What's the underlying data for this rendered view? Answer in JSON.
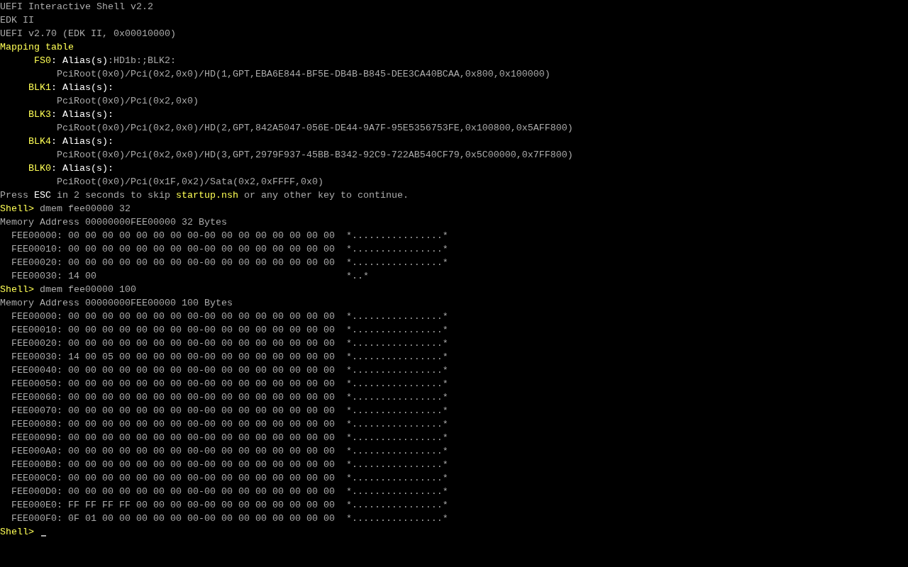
{
  "lines": [
    {
      "parts": [
        {
          "text": "UEFI Interactive Shell v2.2",
          "kind": "text"
        }
      ]
    },
    {
      "parts": [
        {
          "text": "EDK II",
          "kind": "text"
        }
      ]
    },
    {
      "parts": [
        {
          "text": "UEFI v2.70 (EDK II, 0x00010000)",
          "kind": "text"
        }
      ]
    },
    {
      "parts": [
        {
          "text": "Mapping table",
          "kind": "accent"
        }
      ]
    },
    {
      "kind": "mapping",
      "parts": [
        {
          "text": "FS0",
          "kind": "accent"
        },
        {
          "text": ": Alias(s)",
          "kind": "bright"
        },
        {
          "text": ":HD1b:;BLK2:",
          "kind": "text"
        }
      ]
    },
    {
      "parts": [
        {
          "text": "          PciRoot(0x0)/Pci(0x2,0x0)/HD(1,GPT,EBA6E844-BF5E-DB4B-B845-DEE3CA40BCAA,0x800,0x100000)",
          "kind": "text"
        }
      ]
    },
    {
      "kind": "mapping",
      "parts": [
        {
          "text": "BLK1",
          "kind": "accent"
        },
        {
          "text": ": Alias(s):",
          "kind": "bright"
        }
      ]
    },
    {
      "parts": [
        {
          "text": "          PciRoot(0x0)/Pci(0x2,0x0)",
          "kind": "text"
        }
      ]
    },
    {
      "kind": "mapping",
      "parts": [
        {
          "text": "BLK3",
          "kind": "accent"
        },
        {
          "text": ": Alias(s):",
          "kind": "bright"
        }
      ]
    },
    {
      "parts": [
        {
          "text": "          PciRoot(0x0)/Pci(0x2,0x0)/HD(2,GPT,842A5047-056E-DE44-9A7F-95E5356753FE,0x100800,0x5AFF800)",
          "kind": "text"
        }
      ]
    },
    {
      "kind": "mapping",
      "parts": [
        {
          "text": "BLK4",
          "kind": "accent"
        },
        {
          "text": ": Alias(s):",
          "kind": "bright"
        }
      ]
    },
    {
      "parts": [
        {
          "text": "          PciRoot(0x0)/Pci(0x2,0x0)/HD(3,GPT,2979F937-45BB-B342-92C9-722AB540CF79,0x5C00000,0x7FF800)",
          "kind": "text"
        }
      ]
    },
    {
      "kind": "mapping",
      "parts": [
        {
          "text": "BLK0",
          "kind": "accent"
        },
        {
          "text": ": Alias(s):",
          "kind": "bright"
        }
      ]
    },
    {
      "parts": [
        {
          "text": "          PciRoot(0x0)/Pci(0x1F,0x2)/Sata(0x2,0xFFFF,0x0)",
          "kind": "text"
        }
      ]
    },
    {
      "parts": [
        {
          "text": "Press ",
          "kind": "text"
        },
        {
          "text": "ESC",
          "kind": "bright"
        },
        {
          "text": " in 2 seconds to skip ",
          "kind": "text"
        },
        {
          "text": "startup.nsh",
          "kind": "accent"
        },
        {
          "text": " or any other key to continue.",
          "kind": "text"
        }
      ]
    },
    {
      "parts": [
        {
          "text": "Shell>",
          "kind": "accent"
        },
        {
          "text": " dmem fee00000 32",
          "kind": "text"
        }
      ]
    },
    {
      "parts": [
        {
          "text": "Memory Address 00000000FEE00000 32 Bytes",
          "kind": "text"
        }
      ]
    },
    {
      "parts": [
        {
          "text": "  FEE00000: 00 00 00 00 00 00 00 00-00 00 00 00 00 00 00 00  *................*",
          "kind": "text"
        }
      ]
    },
    {
      "parts": [
        {
          "text": "  FEE00010: 00 00 00 00 00 00 00 00-00 00 00 00 00 00 00 00  *................*",
          "kind": "text"
        }
      ]
    },
    {
      "parts": [
        {
          "text": "  FEE00020: 00 00 00 00 00 00 00 00-00 00 00 00 00 00 00 00  *................*",
          "kind": "text"
        }
      ]
    },
    {
      "parts": [
        {
          "text": "  FEE00030: 14 00                                            *..*",
          "kind": "text"
        }
      ]
    },
    {
      "parts": [
        {
          "text": "Shell>",
          "kind": "accent"
        },
        {
          "text": " dmem fee00000 100",
          "kind": "text"
        }
      ]
    },
    {
      "parts": [
        {
          "text": "Memory Address 00000000FEE00000 100 Bytes",
          "kind": "text"
        }
      ]
    },
    {
      "parts": [
        {
          "text": "  FEE00000: 00 00 00 00 00 00 00 00-00 00 00 00 00 00 00 00  *................*",
          "kind": "text"
        }
      ]
    },
    {
      "parts": [
        {
          "text": "  FEE00010: 00 00 00 00 00 00 00 00-00 00 00 00 00 00 00 00  *................*",
          "kind": "text"
        }
      ]
    },
    {
      "parts": [
        {
          "text": "  FEE00020: 00 00 00 00 00 00 00 00-00 00 00 00 00 00 00 00  *................*",
          "kind": "text"
        }
      ]
    },
    {
      "parts": [
        {
          "text": "  FEE00030: 14 00 05 00 00 00 00 00-00 00 00 00 00 00 00 00  *................*",
          "kind": "text"
        }
      ]
    },
    {
      "parts": [
        {
          "text": "  FEE00040: 00 00 00 00 00 00 00 00-00 00 00 00 00 00 00 00  *................*",
          "kind": "text"
        }
      ]
    },
    {
      "parts": [
        {
          "text": "  FEE00050: 00 00 00 00 00 00 00 00-00 00 00 00 00 00 00 00  *................*",
          "kind": "text"
        }
      ]
    },
    {
      "parts": [
        {
          "text": "  FEE00060: 00 00 00 00 00 00 00 00-00 00 00 00 00 00 00 00  *................*",
          "kind": "text"
        }
      ]
    },
    {
      "parts": [
        {
          "text": "  FEE00070: 00 00 00 00 00 00 00 00-00 00 00 00 00 00 00 00  *................*",
          "kind": "text"
        }
      ]
    },
    {
      "parts": [
        {
          "text": "  FEE00080: 00 00 00 00 00 00 00 00-00 00 00 00 00 00 00 00  *................*",
          "kind": "text"
        }
      ]
    },
    {
      "parts": [
        {
          "text": "  FEE00090: 00 00 00 00 00 00 00 00-00 00 00 00 00 00 00 00  *................*",
          "kind": "text"
        }
      ]
    },
    {
      "parts": [
        {
          "text": "  FEE000A0: 00 00 00 00 00 00 00 00-00 00 00 00 00 00 00 00  *................*",
          "kind": "text"
        }
      ]
    },
    {
      "parts": [
        {
          "text": "  FEE000B0: 00 00 00 00 00 00 00 00-00 00 00 00 00 00 00 00  *................*",
          "kind": "text"
        }
      ]
    },
    {
      "parts": [
        {
          "text": "  FEE000C0: 00 00 00 00 00 00 00 00-00 00 00 00 00 00 00 00  *................*",
          "kind": "text"
        }
      ]
    },
    {
      "parts": [
        {
          "text": "  FEE000D0: 00 00 00 00 00 00 00 00-00 00 00 00 00 00 00 00  *................*",
          "kind": "text"
        }
      ]
    },
    {
      "parts": [
        {
          "text": "  FEE000E0: FF FF FF FF 00 00 00 00-00 00 00 00 00 00 00 00  *................*",
          "kind": "text"
        }
      ]
    },
    {
      "parts": [
        {
          "text": "  FEE000F0: 0F 01 00 00 00 00 00 00-00 00 00 00 00 00 00 00  *................*",
          "kind": "text"
        }
      ]
    }
  ],
  "prompt": {
    "label": "Shell>",
    "cursor": true
  }
}
